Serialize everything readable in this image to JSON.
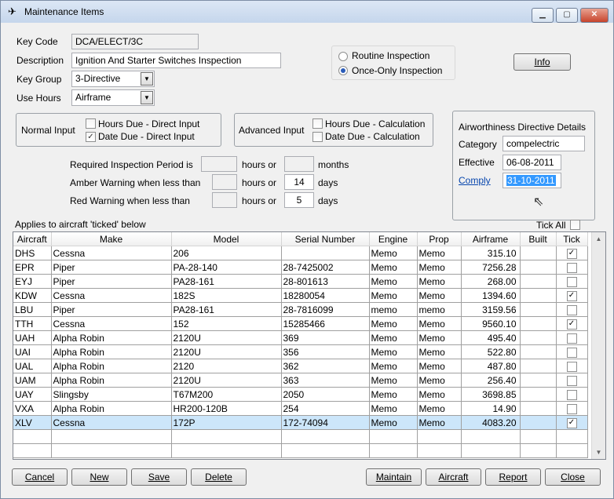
{
  "window": {
    "title": "Maintenance Items",
    "app_icon": "aircraft-icon",
    "minimize_glyph": "▁",
    "maximize_glyph": "▢",
    "close_glyph": "✕"
  },
  "form": {
    "key_code_label": "Key Code",
    "key_code_value": "DCA/ELECT/3C",
    "description_label": "Description",
    "description_value": "Ignition And Starter Switches Inspection",
    "key_group_label": "Key Group",
    "key_group_value": "3-Directive",
    "use_hours_label": "Use Hours",
    "use_hours_value": "Airframe",
    "dropdown_arrow": "▼"
  },
  "inspection_type": {
    "routine_label": "Routine Inspection",
    "once_only_label": "Once-Only Inspection",
    "selected": "once_only"
  },
  "info_button": "Info",
  "normal_input": {
    "label": "Normal Input",
    "hours_due_label": "Hours Due - Direct Input",
    "hours_due_checked": false,
    "date_due_label": "Date Due - Direct Input",
    "date_due_checked": true
  },
  "advanced_input": {
    "label": "Advanced Input",
    "hours_due_label": "Hours Due - Calculation",
    "hours_due_checked": false,
    "date_due_label": "Date Due - Calculation",
    "date_due_checked": false
  },
  "airworthiness": {
    "title": "Airworthiness Directive Details",
    "category_label": "Category",
    "category_value": "compelectric",
    "effective_label": "Effective",
    "effective_value": "06-08-2011",
    "comply_label": "Comply",
    "comply_value": "31-10-2011"
  },
  "periods": {
    "required_label": "Required Inspection Period is",
    "amber_label": "Amber Warning when less than",
    "red_label": "Red Warning when less than",
    "hours_or": "hours or",
    "months": "months",
    "days": "days",
    "required_hours": "",
    "required_months": "",
    "amber_hours": "",
    "amber_days": "14",
    "red_hours": "",
    "red_days": "5"
  },
  "applies_label": "Applies to aircraft 'ticked' below",
  "tick_all_label": "Tick All",
  "check_glyph": "✓",
  "table": {
    "headers": [
      "Aircraft",
      "Make",
      "Model",
      "Serial Number",
      "Engine",
      "Prop",
      "Airframe",
      "Built",
      "Tick"
    ],
    "rows": [
      {
        "aircraft": "DHS",
        "make": "Cessna",
        "model": "206",
        "serial": "",
        "engine": "Memo",
        "prop": "Memo",
        "airframe": "315.10",
        "built": "",
        "tick": true
      },
      {
        "aircraft": "EPR",
        "make": "Piper",
        "model": "PA-28-140",
        "serial": "28-7425002",
        "engine": "Memo",
        "prop": "Memo",
        "airframe": "7256.28",
        "built": "",
        "tick": false
      },
      {
        "aircraft": "EYJ",
        "make": "Piper",
        "model": "PA28-161",
        "serial": "28-801613",
        "engine": "Memo",
        "prop": "Memo",
        "airframe": "268.00",
        "built": "",
        "tick": false
      },
      {
        "aircraft": "KDW",
        "make": "Cessna",
        "model": "182S",
        "serial": "18280054",
        "engine": "Memo",
        "prop": "Memo",
        "airframe": "1394.60",
        "built": "",
        "tick": true
      },
      {
        "aircraft": "LBU",
        "make": "Piper",
        "model": "PA28-161",
        "serial": "28-7816099",
        "engine": "memo",
        "prop": "memo",
        "airframe": "3159.56",
        "built": "",
        "tick": false
      },
      {
        "aircraft": "TTH",
        "make": "Cessna",
        "model": "152",
        "serial": "15285466",
        "engine": "Memo",
        "prop": "Memo",
        "airframe": "9560.10",
        "built": "",
        "tick": true
      },
      {
        "aircraft": "UAH",
        "make": "Alpha Robin",
        "model": "2120U",
        "serial": "369",
        "engine": "Memo",
        "prop": "Memo",
        "airframe": "495.40",
        "built": "",
        "tick": false
      },
      {
        "aircraft": "UAI",
        "make": "Alpha Robin",
        "model": "2120U",
        "serial": "356",
        "engine": "Memo",
        "prop": "Memo",
        "airframe": "522.80",
        "built": "",
        "tick": false
      },
      {
        "aircraft": "UAL",
        "make": "Alpha Robin",
        "model": "2120",
        "serial": "362",
        "engine": "Memo",
        "prop": "Memo",
        "airframe": "487.80",
        "built": "",
        "tick": false
      },
      {
        "aircraft": "UAM",
        "make": "Alpha Robin",
        "model": "2120U",
        "serial": "363",
        "engine": "Memo",
        "prop": "Memo",
        "airframe": "256.40",
        "built": "",
        "tick": false
      },
      {
        "aircraft": "UAY",
        "make": "Slingsby",
        "model": "T67M200",
        "serial": "2050",
        "engine": "Memo",
        "prop": "Memo",
        "airframe": "3698.85",
        "built": "",
        "tick": false
      },
      {
        "aircraft": "VXA",
        "make": "Alpha Robin",
        "model": "HR200-120B",
        "serial": "254",
        "engine": "Memo",
        "prop": "Memo",
        "airframe": "14.90",
        "built": "",
        "tick": false
      },
      {
        "aircraft": "XLV",
        "make": "Cessna",
        "model": "172P",
        "serial": "172-74094",
        "engine": "Memo",
        "prop": "Memo",
        "airframe": "4083.20",
        "built": "",
        "tick": true
      }
    ],
    "selected_row": "XLV",
    "empty_rows": 2
  },
  "buttons": {
    "cancel": "Cancel",
    "new": "New",
    "save": "Save",
    "delete": "Delete",
    "maintain": "Maintain",
    "aircraft": "Aircraft",
    "report": "Report",
    "close": "Close"
  },
  "colors": {
    "selection_highlight": "#cce6fa",
    "link": "#0645ad",
    "text_selection": "#3399ff"
  }
}
